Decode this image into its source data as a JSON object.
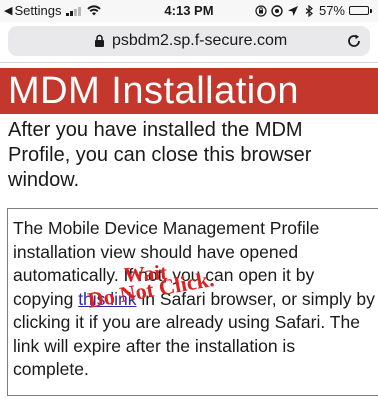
{
  "status_bar": {
    "carrier": "Settings",
    "time": "4:13 PM",
    "battery": "57%",
    "battery_level": 0.57
  },
  "browser": {
    "url": "psbdm2.sp.f-secure.com"
  },
  "page": {
    "title": "MDM Installation",
    "lead": "After you have installed the MDM Profile, you can close this browser window.",
    "notice_before_link": "The Mobile Device Management Profile installation view should have opened automatically. If not, you can open it by copying ",
    "link_text": "this link",
    "notice_after_link": " in Safari browser, or simply by clicking it if you are already using Safari. The link will expire after the installation is complete."
  },
  "annotations": {
    "wait": "Wait",
    "do_not_click": "Do Not Click."
  }
}
